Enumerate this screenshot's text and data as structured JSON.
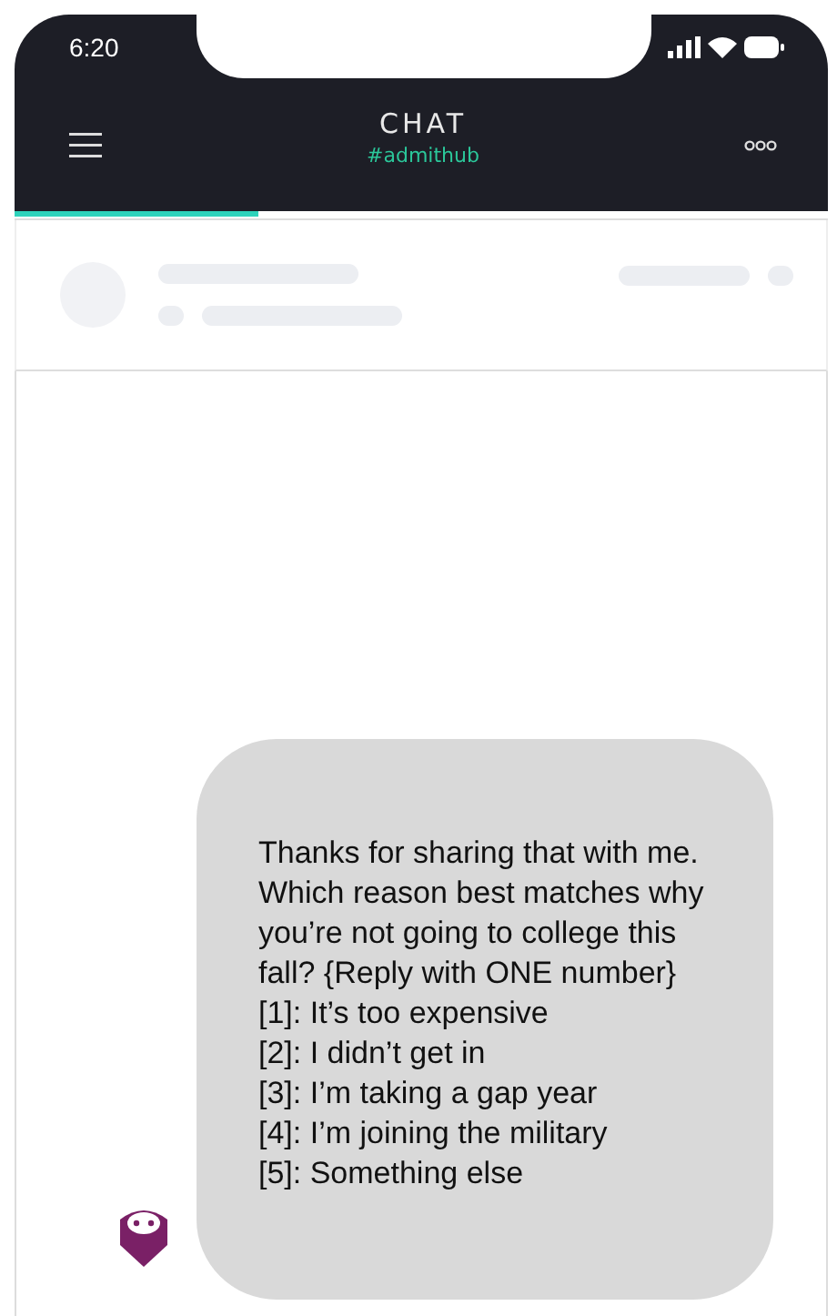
{
  "status_bar": {
    "time": "6:20"
  },
  "header": {
    "title": "CHAT",
    "subtitle": "#admithub"
  },
  "progress": {
    "level": 0.3
  },
  "message": {
    "text": "Thanks for sharing that with me. Which reason best matches why you’re not going to college this fall? {Reply with ONE number}",
    "options": [
      "[1]: It’s too expensive",
      "[2]: I didn’t get in",
      "[3]: I’m taking a gap year",
      "[4]: I’m joining the military",
      "[5]: Something else"
    ]
  }
}
